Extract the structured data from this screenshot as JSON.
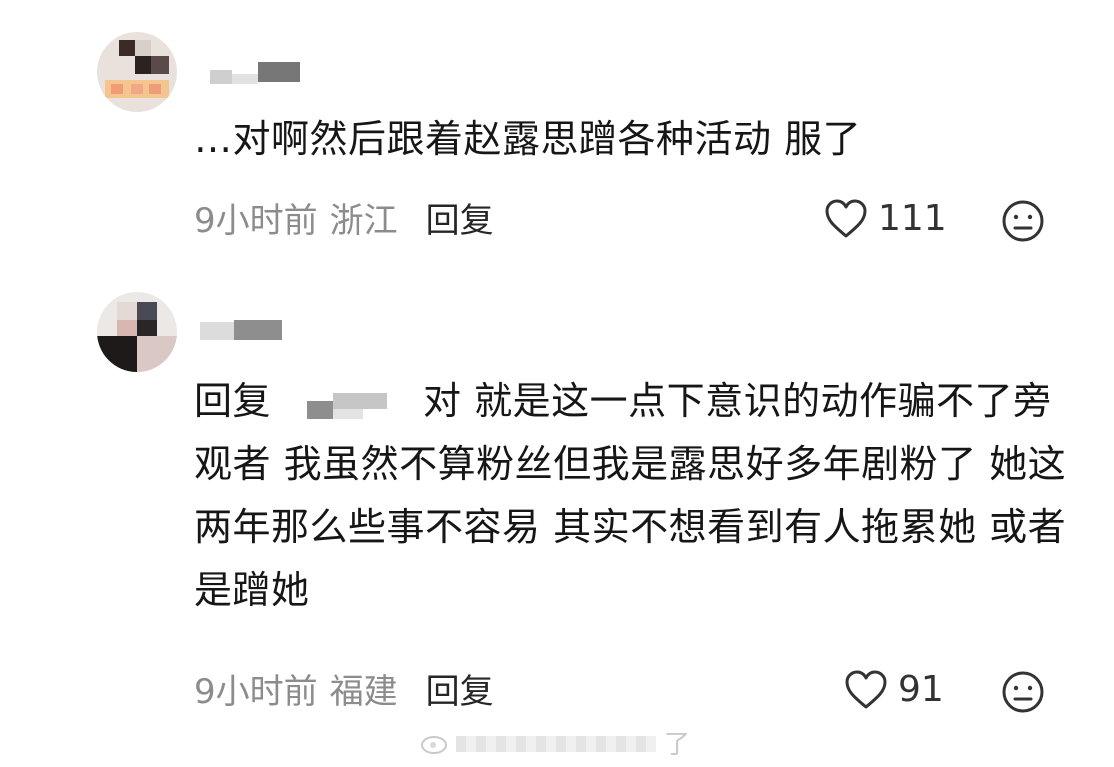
{
  "comments": [
    {
      "text": "…对啊然后跟着赵露思蹭各种活动 服了",
      "time": "9小时前",
      "location": "浙江",
      "reply_label": "回复",
      "likes": "111",
      "avatar_icon": "user-avatar",
      "like_icon": "heart-icon",
      "dislike_icon": "frown-face-icon"
    },
    {
      "reply_prefix": "回复",
      "text": "对 就是这一点下意识的动作骗不了旁观者 我虽然不算粉丝但我是露思好多年剧粉了 她这两年那么些事不容易 其实不想看到有人拖累她 或者是蹭她",
      "time": "9小时前",
      "location": "福建",
      "reply_label": "回复",
      "likes": "91",
      "avatar_icon": "user-avatar",
      "like_icon": "heart-icon",
      "dislike_icon": "frown-face-icon"
    }
  ],
  "watermark": {
    "text": "了"
  },
  "colors": {
    "text": "#161616",
    "meta": "#8c8c8c",
    "background": "#ffffff"
  }
}
